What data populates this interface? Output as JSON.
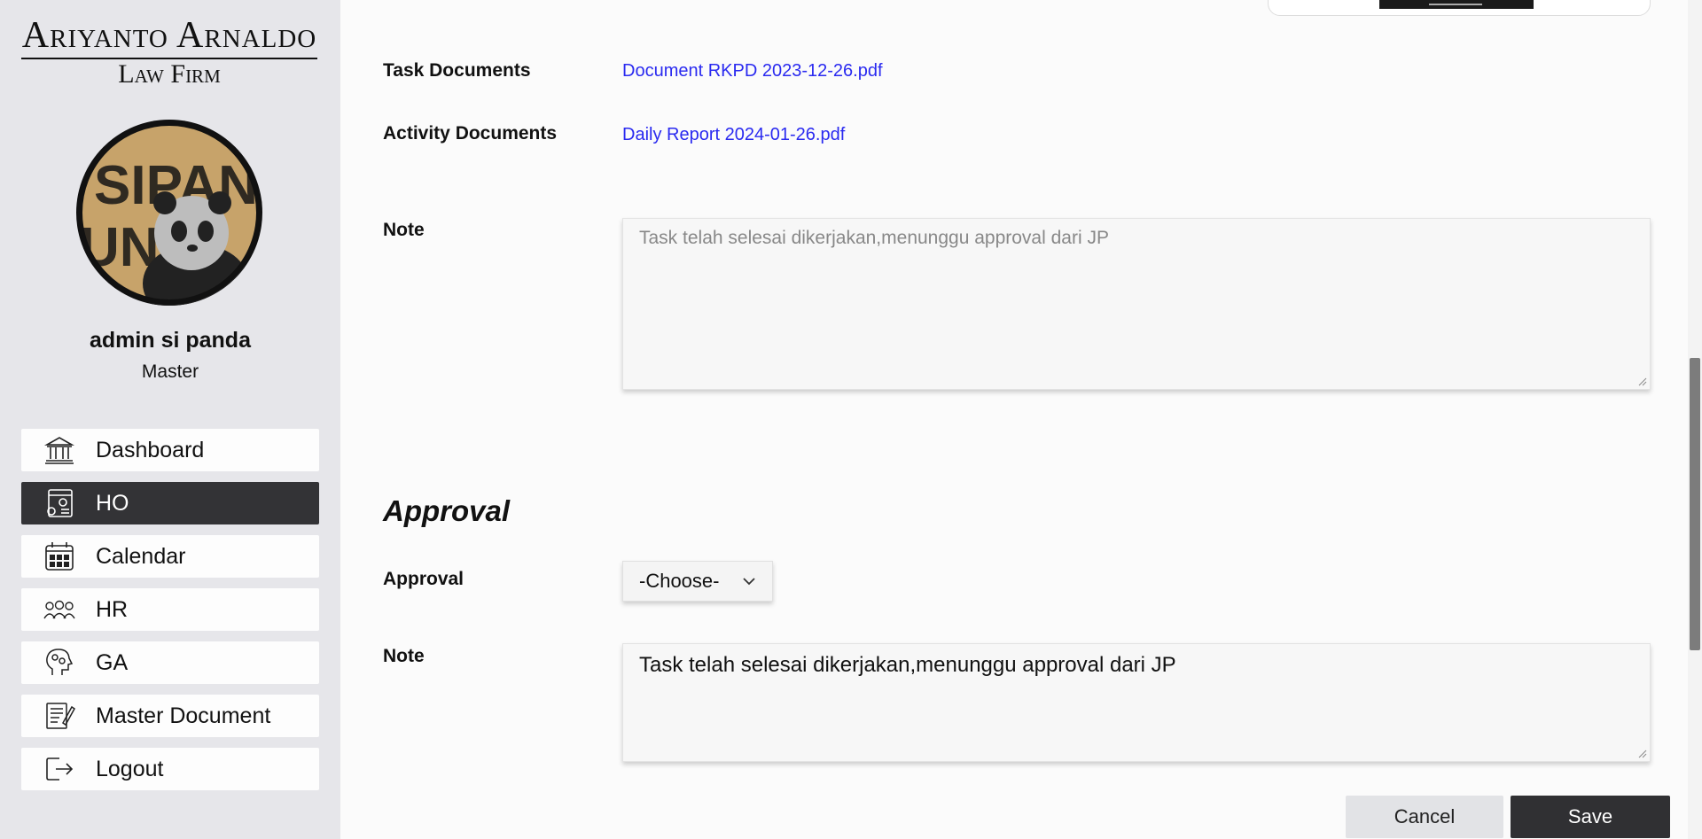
{
  "brand": {
    "line1": "Ariyanto Arnaldo",
    "line2": "Law Firm"
  },
  "avatar": {
    "text": "SIPANDA UNIK"
  },
  "user": {
    "name": "admin si panda",
    "role": "Master"
  },
  "menu": [
    {
      "label": "Dashboard",
      "icon": "bank-icon",
      "active": false
    },
    {
      "label": "HO",
      "icon": "settings-window-icon",
      "active": true
    },
    {
      "label": "Calendar",
      "icon": "calendar-icon",
      "active": false
    },
    {
      "label": "HR",
      "icon": "people-icon",
      "active": false
    },
    {
      "label": "GA",
      "icon": "head-gears-icon",
      "active": false
    },
    {
      "label": "Master Document",
      "icon": "document-edit-icon",
      "active": false
    },
    {
      "label": "Logout",
      "icon": "logout-icon",
      "active": false
    }
  ],
  "task_documents": {
    "label": "Task Documents",
    "file": "Document RKPD 2023-12-26.pdf"
  },
  "activity_documents": {
    "label": "Activity Documents",
    "file": "Daily Report 2024-01-26.pdf"
  },
  "note_readonly": {
    "label": "Note",
    "value": "Task telah selesai dikerjakan,menunggu approval dari JP"
  },
  "approval_section": {
    "title": "Approval",
    "approval_label": "Approval",
    "approval_selected": "-Choose-",
    "note_label": "Note",
    "note_value": "Task telah selesai dikerjakan,menunggu approval dari JP"
  },
  "buttons": {
    "cancel": "Cancel",
    "save": "Save"
  },
  "colors": {
    "sidebar_bg": "#e6e6ea",
    "active_bg": "#333336",
    "link": "#2a2af0",
    "save_bg": "#303033"
  }
}
